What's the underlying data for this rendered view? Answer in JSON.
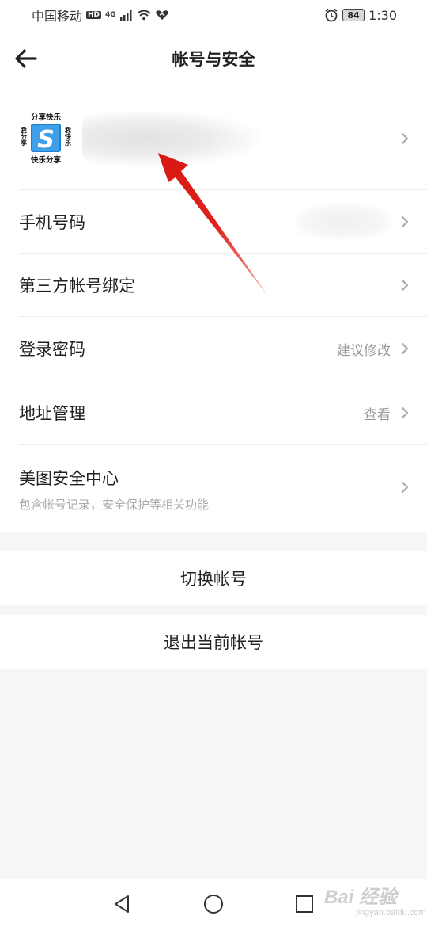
{
  "status_bar": {
    "carrier": "中国移动",
    "hd_badge": "HD",
    "network": "4G",
    "battery": "84",
    "time": "1:30"
  },
  "header": {
    "title": "帐号与安全",
    "back_icon": "arrow-left-icon"
  },
  "profile": {
    "avatar_texts": [
      "分享快乐",
      "我分享",
      "我快乐",
      "快乐分享"
    ],
    "avatar_letter": "S"
  },
  "rows": [
    {
      "label": "手机号码",
      "value": ""
    },
    {
      "label": "第三方帐号绑定",
      "value": ""
    },
    {
      "label": "登录密码",
      "value": "建议修改"
    },
    {
      "label": "地址管理",
      "value": "查看"
    },
    {
      "label": "美图安全中心",
      "value": "",
      "subtitle": "包含帐号记录，安全保护等相关功能"
    }
  ],
  "actions": {
    "switch_account": "切换帐号",
    "logout": "退出当前帐号"
  },
  "system_nav": [
    "back-triangle-icon",
    "home-circle-icon",
    "recents-square-icon"
  ],
  "watermark": {
    "brand": "Bai 经验",
    "url": "jingyan.baidu.com"
  },
  "colors": {
    "background": "#f5f6f8",
    "card": "#ffffff",
    "hint_text": "#999999",
    "annotation_arrow": "#e0221c"
  }
}
